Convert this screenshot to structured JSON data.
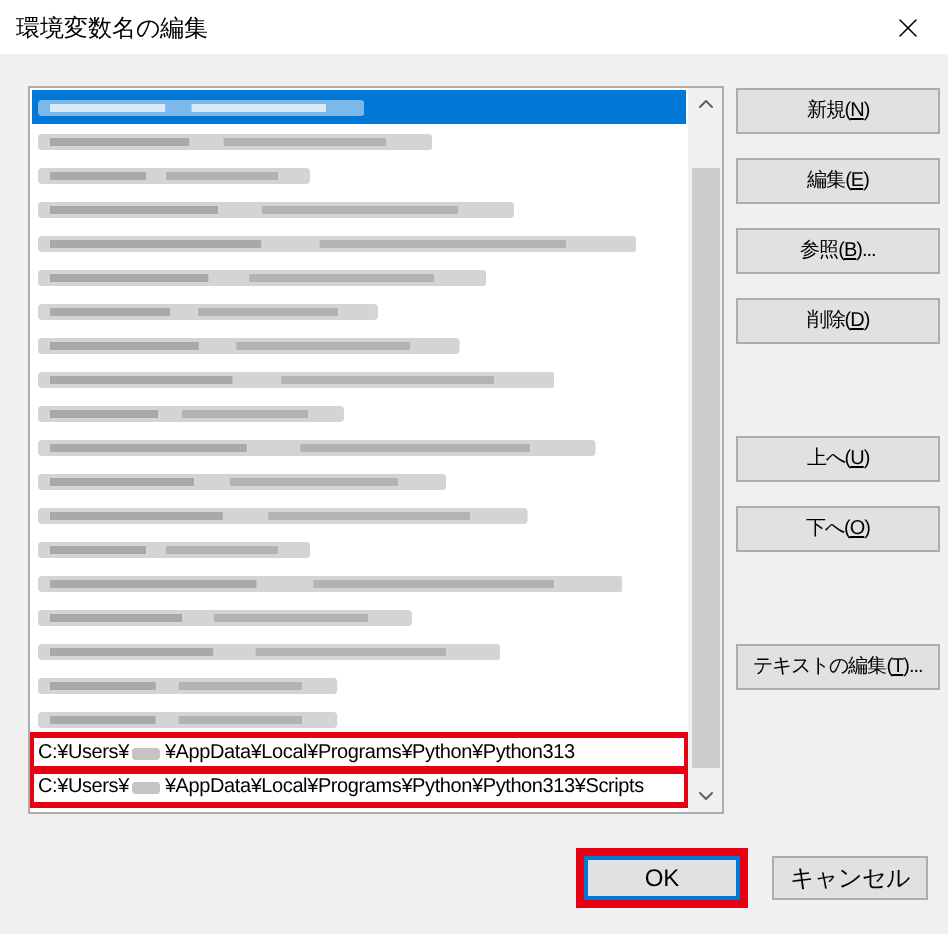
{
  "window": {
    "title": "環境変数名の編集"
  },
  "list": {
    "rows": [
      {
        "kind": "blurred",
        "selected": true,
        "highlighted": false
      },
      {
        "kind": "blurred",
        "selected": false,
        "highlighted": false
      },
      {
        "kind": "blurred",
        "selected": false,
        "highlighted": false
      },
      {
        "kind": "blurred",
        "selected": false,
        "highlighted": false
      },
      {
        "kind": "blurred",
        "selected": false,
        "highlighted": false
      },
      {
        "kind": "blurred",
        "selected": false,
        "highlighted": false
      },
      {
        "kind": "blurred",
        "selected": false,
        "highlighted": false
      },
      {
        "kind": "blurred",
        "selected": false,
        "highlighted": false
      },
      {
        "kind": "blurred",
        "selected": false,
        "highlighted": false
      },
      {
        "kind": "blurred",
        "selected": false,
        "highlighted": false
      },
      {
        "kind": "blurred",
        "selected": false,
        "highlighted": false
      },
      {
        "kind": "blurred",
        "selected": false,
        "highlighted": false
      },
      {
        "kind": "blurred",
        "selected": false,
        "highlighted": false
      },
      {
        "kind": "blurred",
        "selected": false,
        "highlighted": false
      },
      {
        "kind": "blurred",
        "selected": false,
        "highlighted": false
      },
      {
        "kind": "blurred",
        "selected": false,
        "highlighted": false
      },
      {
        "kind": "blurred",
        "selected": false,
        "highlighted": false
      },
      {
        "kind": "blurred",
        "selected": false,
        "highlighted": false
      },
      {
        "kind": "blurred",
        "selected": false,
        "highlighted": false
      },
      {
        "kind": "path",
        "prefix": "C:¥Users¥",
        "suffix": "¥AppData¥Local¥Programs¥Python¥Python313",
        "selected": false,
        "highlighted": true
      },
      {
        "kind": "path",
        "prefix": "C:¥Users¥",
        "suffix": "¥AppData¥Local¥Programs¥Python¥Python313¥Scripts",
        "selected": false,
        "highlighted": true
      }
    ]
  },
  "side_button_groups": [
    [
      {
        "parts": [
          "新規(",
          "N",
          ")"
        ]
      },
      {
        "parts": [
          "編集(",
          "E",
          ")"
        ]
      },
      {
        "parts": [
          "参照(",
          "B",
          ")..."
        ]
      },
      {
        "parts": [
          "削除(",
          "D",
          ")"
        ]
      }
    ],
    [
      {
        "parts": [
          "上へ(",
          "U",
          ")"
        ]
      },
      {
        "parts": [
          "下へ(",
          "O",
          ")"
        ]
      }
    ],
    [
      {
        "parts": [
          "テキストの編集(",
          "T",
          ")..."
        ]
      }
    ]
  ],
  "footer_buttons": [
    {
      "label": "OK",
      "default": true,
      "highlighted": true
    },
    {
      "label": "キャンセル",
      "default": false,
      "highlighted": false
    }
  ]
}
